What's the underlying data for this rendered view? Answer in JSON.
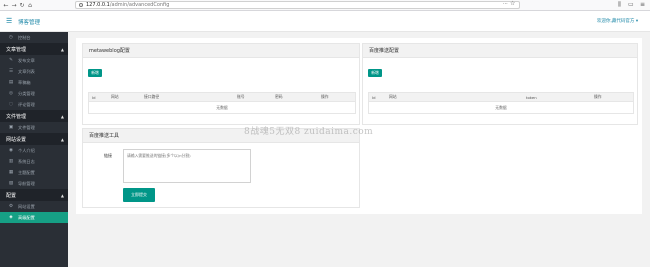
{
  "browser": {
    "url_host": "127.0.0.1",
    "url_path": "/admin/advancedConfig",
    "more": "···"
  },
  "header": {
    "title": "博客管理",
    "welcome": "欢迎你,藏代码官方 ▾"
  },
  "sidebar": {
    "items": [
      {
        "type": "item",
        "icon": "dashboard-icon",
        "glyph": "◷",
        "label": "控制台"
      },
      {
        "type": "group",
        "label": "文章管理"
      },
      {
        "type": "item",
        "icon": "edit-icon",
        "glyph": "✎",
        "label": "发布文章"
      },
      {
        "type": "item",
        "icon": "list-icon",
        "glyph": "☰",
        "label": "文章列表"
      },
      {
        "type": "item",
        "icon": "draft-icon",
        "glyph": "▤",
        "label": "草稿箱"
      },
      {
        "type": "item",
        "icon": "category-icon",
        "glyph": "◎",
        "label": "分类管理"
      },
      {
        "type": "item",
        "icon": "comment-icon",
        "glyph": "◌",
        "label": "评论管理"
      },
      {
        "type": "group",
        "label": "文件管理"
      },
      {
        "type": "item",
        "icon": "file-icon",
        "glyph": "▣",
        "label": "文件管理"
      },
      {
        "type": "group",
        "label": "网站设置"
      },
      {
        "type": "item",
        "icon": "user-icon",
        "glyph": "◉",
        "label": "个人介绍"
      },
      {
        "type": "item",
        "icon": "log-icon",
        "glyph": "▥",
        "label": "系统日志"
      },
      {
        "type": "item",
        "icon": "theme-icon",
        "glyph": "▦",
        "label": "主题配置"
      },
      {
        "type": "item",
        "icon": "nav-icon",
        "glyph": "▧",
        "label": "导航管理"
      },
      {
        "type": "group",
        "label": "配置"
      },
      {
        "type": "item",
        "icon": "settings-icon",
        "glyph": "⚙",
        "label": "网站设置"
      },
      {
        "type": "item",
        "icon": "advanced-icon",
        "glyph": "◈",
        "label": "高级配置",
        "active": true
      }
    ]
  },
  "metaweblog": {
    "title": "metaweblog配置",
    "new_button": "新增",
    "columns": [
      "Id",
      "网站",
      "接口路径",
      "账号",
      "密码",
      "操作"
    ],
    "empty": "无数据"
  },
  "baidu_push_config": {
    "title": "百度推送配置",
    "new_button": "新增",
    "columns": [
      "Id",
      "网站",
      "token",
      "操作"
    ],
    "empty": "无数据"
  },
  "baidu_tool": {
    "title": "百度推送工具",
    "label": "链接",
    "placeholder": "请输入需要推送的链接(多个以\\n分割)",
    "submit": "立即提交"
  },
  "watermark": "8战魂5无双8 zuidaima.com"
}
